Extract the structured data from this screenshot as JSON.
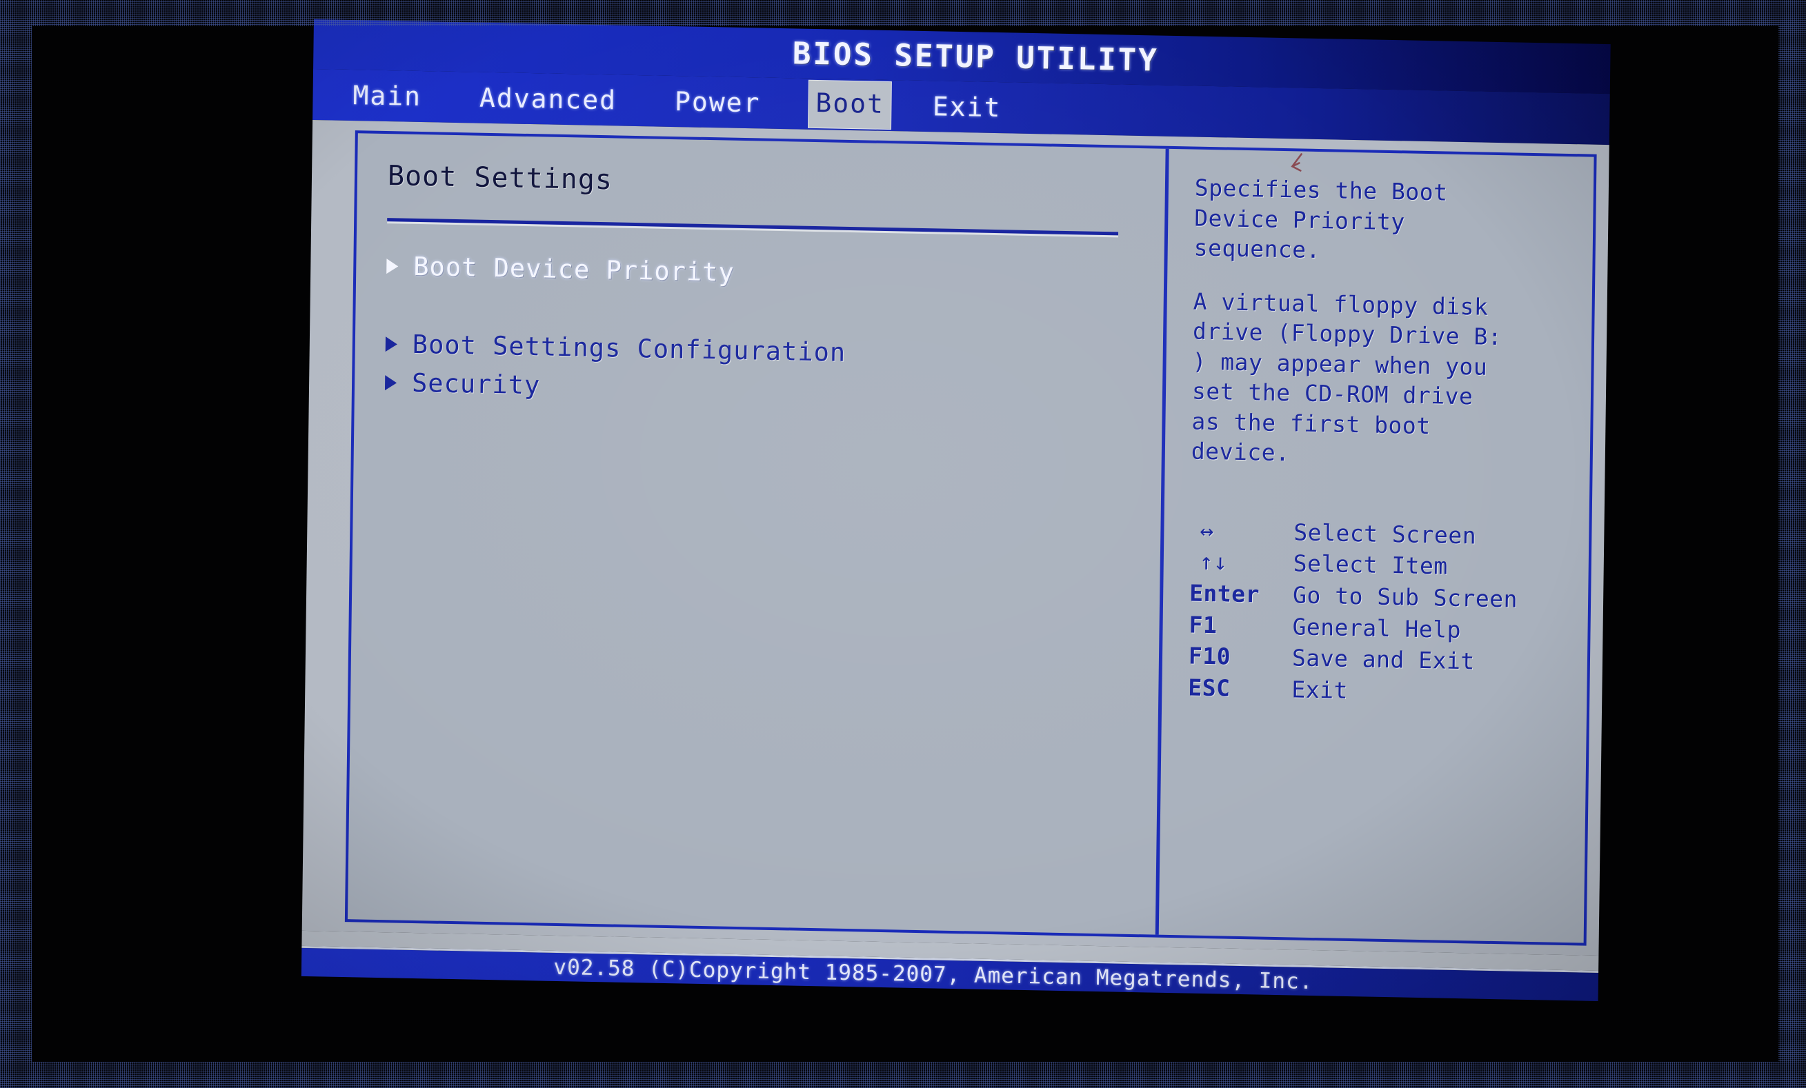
{
  "header": {
    "title": "BIOS SETUP UTILITY"
  },
  "menu": {
    "tabs": [
      {
        "label": "Main",
        "active": false
      },
      {
        "label": "Advanced",
        "active": false
      },
      {
        "label": "Power",
        "active": false
      },
      {
        "label": "Boot",
        "active": true
      },
      {
        "label": "Exit",
        "active": false
      }
    ]
  },
  "main": {
    "section_title": "Boot Settings",
    "items": [
      {
        "label": "Boot Device Priority",
        "selected": true
      },
      {
        "label": "Boot Settings Configuration",
        "selected": false
      },
      {
        "label": "Security",
        "selected": false
      }
    ]
  },
  "help": {
    "paragraphs": [
      "Specifies the Boot\nDevice Priority\nsequence.",
      "A virtual floppy disk\ndrive (Floppy Drive B:\n) may appear when you\nset the CD-ROM drive\nas the first boot\ndevice."
    ],
    "keys": [
      {
        "key": "↔",
        "desc": "Select Screen",
        "glyph": true
      },
      {
        "key": "↑↓",
        "desc": "Select Item",
        "glyph": true
      },
      {
        "key": "Enter",
        "desc": "Go to Sub Screen",
        "glyph": false
      },
      {
        "key": "F1",
        "desc": "General Help",
        "glyph": false
      },
      {
        "key": "F10",
        "desc": "Save and Exit",
        "glyph": false
      },
      {
        "key": "ESC",
        "desc": "Exit",
        "glyph": false
      }
    ]
  },
  "footer": {
    "copyright": "v02.58 (C)Copyright 1985-2007, American Megatrends, Inc."
  },
  "colors": {
    "title_bar_blue": "#1628b4",
    "menu_bar_blue": "#1829b5",
    "panel_gray": "#a9b1bd",
    "body_gray": "#b4bac4",
    "text_blue": "#17249c",
    "selected_white": "#f4f6ff",
    "active_tab_bg": "#b9bfc8",
    "border_blue": "#1a2bb8",
    "footer_blue": "#1828b2"
  }
}
